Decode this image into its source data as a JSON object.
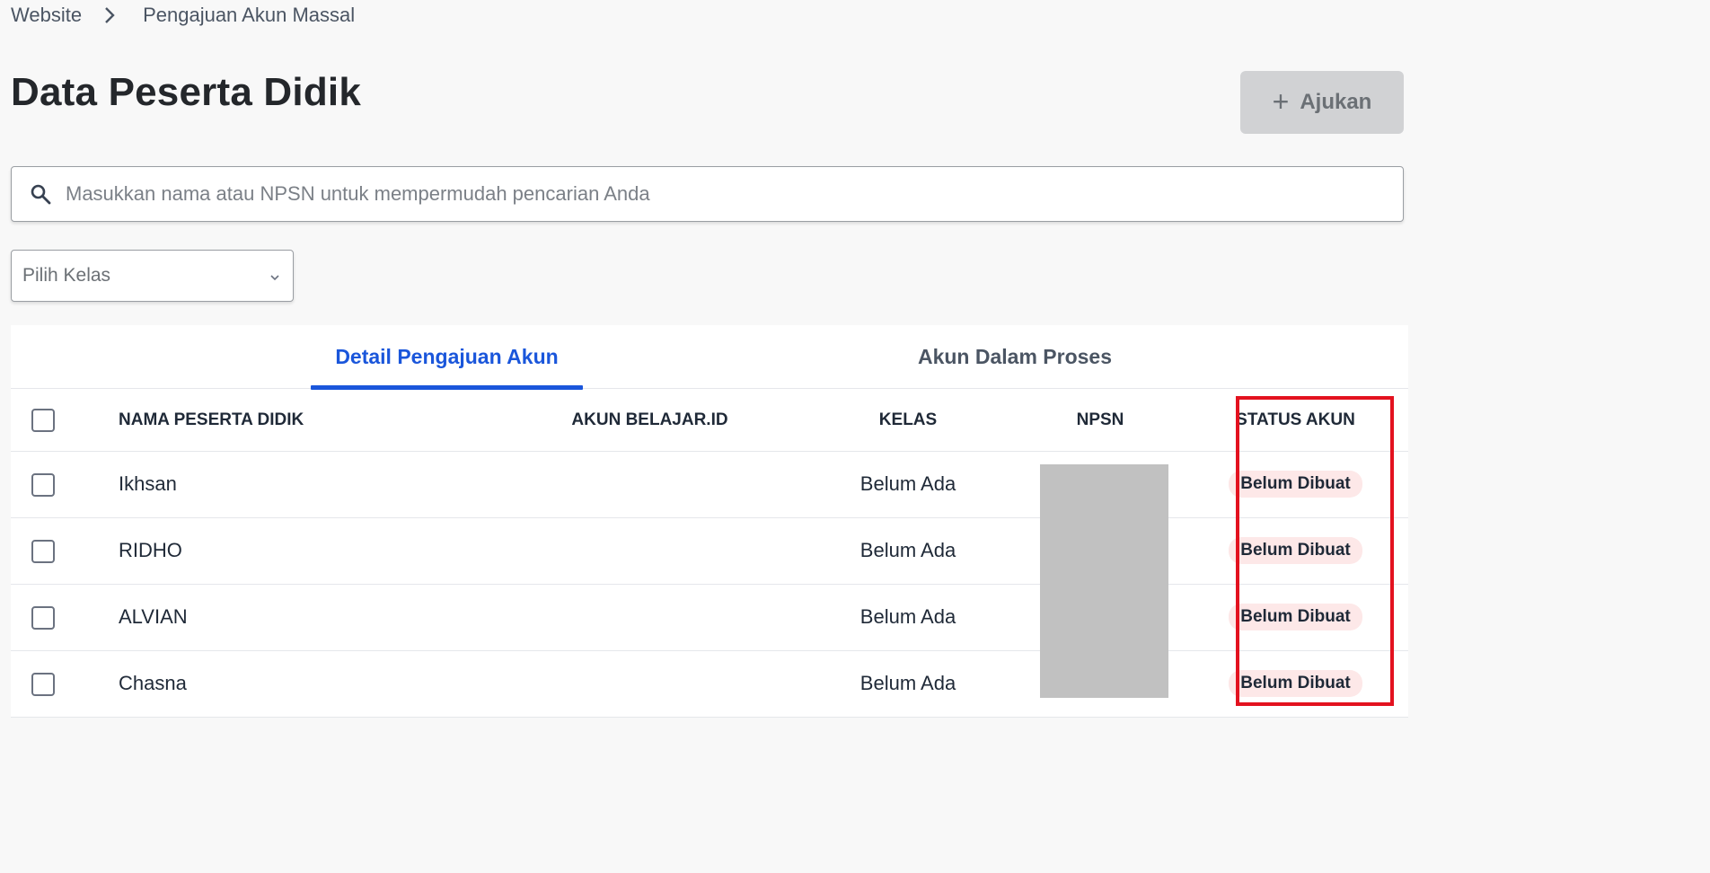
{
  "breadcrumb": {
    "root": "Website",
    "current": "Pengajuan Akun Massal"
  },
  "page": {
    "title": "Data Peserta Didik"
  },
  "actions": {
    "ajukan_label": "Ajukan",
    "ajukan_icon": "plus-icon"
  },
  "search": {
    "placeholder": "Masukkan nama atau NPSN untuk mempermudah pencarian Anda",
    "value": "",
    "icon": "search-icon"
  },
  "filter": {
    "kelas_placeholder": "Pilih Kelas",
    "icon": "chevron-down-icon"
  },
  "tabs": [
    {
      "label": "Detail Pengajuan Akun",
      "active": true
    },
    {
      "label": "Akun Dalam Proses",
      "active": false
    }
  ],
  "table": {
    "columns": [
      "NAMA PESERTA DIDIK",
      "AKUN BELAJAR.ID",
      "KELAS",
      "NPSN",
      "STATUS AKUN"
    ],
    "rows": [
      {
        "nama": "Ikhsan",
        "akun": "",
        "kelas": "Belum Ada",
        "status": "Belum Dibuat"
      },
      {
        "nama": "RIDHO",
        "akun": "",
        "kelas": "Belum Ada",
        "status": "Belum Dibuat"
      },
      {
        "nama": "ALVIAN",
        "akun": "",
        "kelas": "Belum Ada",
        "status": "Belum Dibuat"
      },
      {
        "nama": "Chasna",
        "akun": "",
        "kelas": "Belum Ada",
        "status": "Belum Dibuat"
      }
    ]
  },
  "colors": {
    "accent": "#1a56db",
    "badge_bg": "#fde8e8",
    "highlight": "#e3121f",
    "button_disabled": "#d1d2d4"
  }
}
